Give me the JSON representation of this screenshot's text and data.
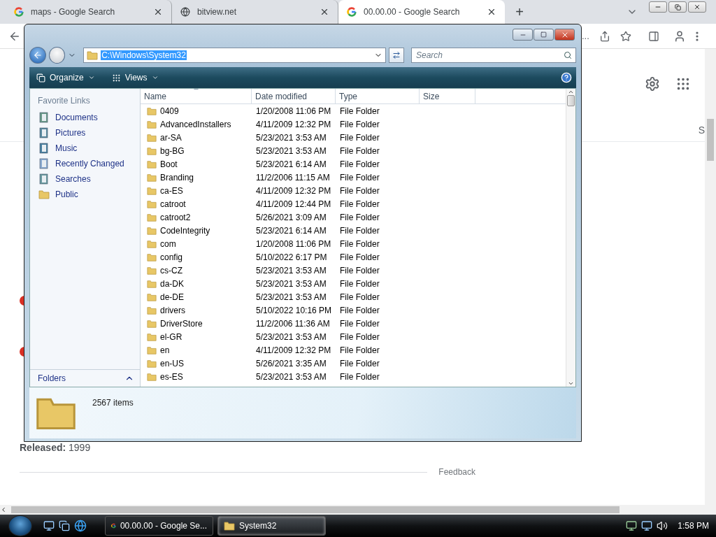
{
  "browser": {
    "tabs": [
      {
        "title": "maps - Google Search",
        "kind": "google",
        "selected": false
      },
      {
        "title": "bitview.net",
        "kind": "web",
        "selected": false
      },
      {
        "title": "00.00.00 - Google Search",
        "kind": "google",
        "selected": true
      }
    ],
    "new_tab": "+",
    "omnibox_tail": "...",
    "fragments": [
      {
        "kind": "dot"
      },
      {
        "kind": "dot"
      }
    ],
    "right_fragment": "S",
    "released": "**Released:** 1999",
    "feedback": "Feedback"
  },
  "explorer": {
    "address": "C:\\Windows\\System32",
    "search_placeholder": "Search",
    "toolbar": [
      "Organize",
      "Views"
    ],
    "favorites_title": "Favorite Links",
    "favorites": [
      {
        "label": "Documents",
        "kind": "documents"
      },
      {
        "label": "Pictures",
        "kind": "pictures"
      },
      {
        "label": "Music",
        "kind": "music"
      },
      {
        "label": "Recently Changed",
        "kind": "recent"
      },
      {
        "label": "Searches",
        "kind": "searches"
      },
      {
        "label": "Public",
        "kind": "folder"
      }
    ],
    "folders_label": "Folders",
    "columns": [
      "Name",
      "Date modified",
      "Type",
      "Size"
    ],
    "rows": [
      {
        "name": "0409",
        "date": "1/20/2008 11:06 PM",
        "type": "File Folder"
      },
      {
        "name": "AdvancedInstallers",
        "date": "4/11/2009 12:32 PM",
        "type": "File Folder"
      },
      {
        "name": "ar-SA",
        "date": "5/23/2021 3:53 AM",
        "type": "File Folder"
      },
      {
        "name": "bg-BG",
        "date": "5/23/2021 3:53 AM",
        "type": "File Folder"
      },
      {
        "name": "Boot",
        "date": "5/23/2021 6:14 AM",
        "type": "File Folder"
      },
      {
        "name": "Branding",
        "date": "11/2/2006 11:15 AM",
        "type": "File Folder"
      },
      {
        "name": "ca-ES",
        "date": "4/11/2009 12:32 PM",
        "type": "File Folder"
      },
      {
        "name": "catroot",
        "date": "4/11/2009 12:44 PM",
        "type": "File Folder"
      },
      {
        "name": "catroot2",
        "date": "5/26/2021 3:09 AM",
        "type": "File Folder"
      },
      {
        "name": "CodeIntegrity",
        "date": "5/23/2021 6:14 AM",
        "type": "File Folder"
      },
      {
        "name": "com",
        "date": "1/20/2008 11:06 PM",
        "type": "File Folder"
      },
      {
        "name": "config",
        "date": "5/10/2022 6:17 PM",
        "type": "File Folder"
      },
      {
        "name": "cs-CZ",
        "date": "5/23/2021 3:53 AM",
        "type": "File Folder"
      },
      {
        "name": "da-DK",
        "date": "5/23/2021 3:53 AM",
        "type": "File Folder"
      },
      {
        "name": "de-DE",
        "date": "5/23/2021 3:53 AM",
        "type": "File Folder"
      },
      {
        "name": "drivers",
        "date": "5/10/2022 10:16 PM",
        "type": "File Folder"
      },
      {
        "name": "DriverStore",
        "date": "11/2/2006 11:36 AM",
        "type": "File Folder"
      },
      {
        "name": "el-GR",
        "date": "5/23/2021 3:53 AM",
        "type": "File Folder"
      },
      {
        "name": "en",
        "date": "4/11/2009 12:32 PM",
        "type": "File Folder"
      },
      {
        "name": "en-US",
        "date": "5/26/2021 3:35 AM",
        "type": "File Folder"
      },
      {
        "name": "es-ES",
        "date": "5/23/2021 3:53 AM",
        "type": "File Folder"
      }
    ],
    "item_count": "2567 items"
  },
  "taskbar": {
    "tasks": [
      {
        "label": "00.00.00 - Google Se...",
        "kind": "browser",
        "selected": false
      },
      {
        "label": "System32",
        "kind": "folder",
        "selected": true
      }
    ],
    "clock": "1:58 PM"
  }
}
